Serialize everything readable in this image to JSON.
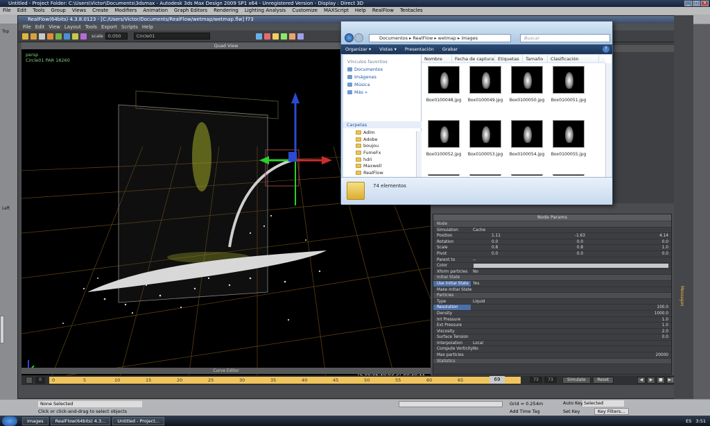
{
  "max_title": "Untitled    - Project Folder: C:\\Users\\Victor\\Documents\\3dsmax    - Autodesk 3ds Max Design 2009 SP1  x64   - Unregistered Version    - Display : Direct 3D",
  "max_menu": [
    "File",
    "Edit",
    "Tools",
    "Group",
    "Views",
    "Create",
    "Modifiers",
    "Animation",
    "Graph Editors",
    "Rendering",
    "Lighting Analysis",
    "Customize",
    "MAXScript",
    "Help",
    "RealFlow",
    "Tentacles"
  ],
  "left_labels": {
    "top": "Top",
    "left": "Left"
  },
  "realflow": {
    "title": "RealFlow(64bits) 4.3.8.0123 - [C:/Users/Victor/Documents/RealFlow/wetmap/wetmap.flw] f73",
    "menu": [
      "File",
      "Edit",
      "View",
      "Layout",
      "Tools",
      "Export",
      "Scripts",
      "Help"
    ],
    "scale_label": "scale",
    "scale_value": "0.050",
    "object_value": "Circle01",
    "viewport_header": "Quad View",
    "vp_label1": "persp",
    "vp_label2": "Circle01 PAR 18260",
    "timecode": "TC 00:02:18:69    ST 00:18:11",
    "curve_editor": "Curve Editor",
    "global_links": "Global Links",
    "messages_tab": "Messages"
  },
  "node_params": {
    "header": "Node Params",
    "rows": [
      {
        "type": "sec",
        "k": "Node"
      },
      {
        "k": "Simulation",
        "v": "Cache"
      },
      {
        "k": "Position",
        "v3": [
          "1.11",
          "-1.63",
          "4.14"
        ]
      },
      {
        "k": "Rotation",
        "v3": [
          "0.0",
          "0.0",
          "0.0"
        ]
      },
      {
        "k": "Scale",
        "v3": [
          "0.8",
          "0.8",
          "1.0"
        ]
      },
      {
        "k": "Pivot",
        "v3": [
          "0.0",
          "0.0",
          "0.0"
        ]
      },
      {
        "k": "Parent to",
        "v": "--"
      },
      {
        "k": "Color",
        "color": "#c8c8c8"
      },
      {
        "k": "Xform particles",
        "v": "No"
      },
      {
        "type": "sec",
        "k": "Initial State"
      },
      {
        "k": "Use Initial State",
        "v": "Yes",
        "hl": true
      },
      {
        "k": "   Make Initial State",
        "v": ""
      },
      {
        "type": "sec",
        "k": "Particles"
      },
      {
        "k": "Type",
        "v": "Liquid"
      },
      {
        "k": "Resolution",
        "num": "100.0",
        "hl": true
      },
      {
        "k": "Density",
        "num": "1000.0"
      },
      {
        "k": "Int Pressure",
        "num": "1.0"
      },
      {
        "k": "Ext Pressure",
        "num": "1.0"
      },
      {
        "k": "Viscosity",
        "num": "2.0"
      },
      {
        "k": "Surface Tension",
        "num": "0.0"
      },
      {
        "k": "Interpolation",
        "v": "Local"
      },
      {
        "k": "Compute Vorticity",
        "v": "No"
      },
      {
        "k": "Max particles",
        "num": "20000"
      },
      {
        "type": "sec",
        "k": "Statistics"
      }
    ]
  },
  "timeline": {
    "ticks": [
      "0",
      "5",
      "10",
      "15",
      "20",
      "25",
      "30",
      "35",
      "40",
      "45",
      "50",
      "55",
      "60",
      "65"
    ],
    "current_frame": "69",
    "start": "73",
    "end": "73",
    "simulate": "Simulate",
    "reset": "Reset",
    "percent": "0%",
    "progress": 0.0
  },
  "status": {
    "none_selected": "None Selected",
    "hint": "Click or click-and-drag to select objects",
    "grid": "Grid = 0.254m",
    "add_time_tag": "Add Time Tag",
    "auto_key": "Auto Key",
    "selected": "Selected",
    "set_key": "Set Key",
    "key_filters": "Key Filters..."
  },
  "taskbar": {
    "items": [
      "images",
      "RealFlow(64bits) 4.3...",
      "Untitled    - Project..."
    ],
    "lang": "ES",
    "time": "3:51"
  },
  "explorer": {
    "address": "Documentos  ▸ RealFlow  ▸ wetmap  ▸ images",
    "search_placeholder": "Buscar",
    "commands": [
      "Organizar ▾",
      "Vistas ▾",
      "Presentación",
      "Grabar"
    ],
    "favorites_header": "Vínculos favoritos",
    "favorites": [
      "Documentos",
      "Imágenes",
      "Música",
      "Más  »"
    ],
    "folders_header": "Carpetas",
    "folders": [
      "Adlm",
      "Adobe",
      "boujou",
      "FumeFx",
      "hdri",
      "Maxwell",
      "RealFlow",
      "dt",
      "dt01",
      "pasillo"
    ],
    "columns": [
      "Nombre",
      "Fecha de captura",
      "Etiquetas",
      "Tamaño",
      "Clasificación"
    ],
    "files": [
      "Box0100048.jpg",
      "Box0100049.jpg",
      "Box0100050.jpg",
      "Box0100051.jpg",
      "Box0100052.jpg",
      "Box0100053.jpg",
      "Box0100054.jpg",
      "Box0100055.jpg",
      "",
      "",
      "",
      ""
    ],
    "count": "74 elementos"
  }
}
